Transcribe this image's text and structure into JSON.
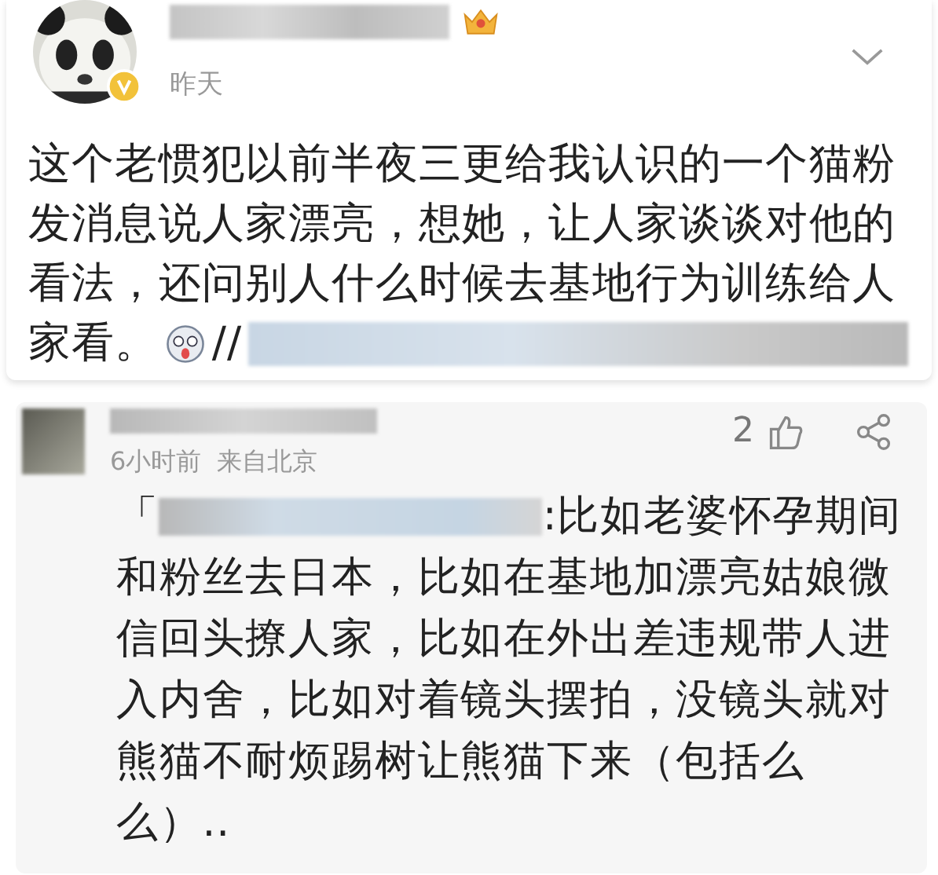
{
  "post": {
    "time": "昨天",
    "lines": [
      "这个老惯犯以前半夜三更给我认识的一个猫粉",
      "发消息说人家漂亮，想她，让人家谈谈对他的",
      "看法，还问别人什么时候去基地行为训练给人"
    ],
    "last_line": "家看。",
    "repost_mark": "//"
  },
  "comment": {
    "likes": "2",
    "time": "6小时前",
    "location": "来自北京",
    "quote_mark": "「",
    "first_line": ":比如老婆怀孕期间",
    "lines": [
      "和粉丝去日本，比如在基地加漂亮姑娘微",
      "信回头撩人家，比如在外出差违规带人进",
      "入内舍，比如对着镜头摆拍，没镜头就对",
      "熊猫不耐烦踢树让熊猫下来（包括么",
      "么）.."
    ]
  }
}
